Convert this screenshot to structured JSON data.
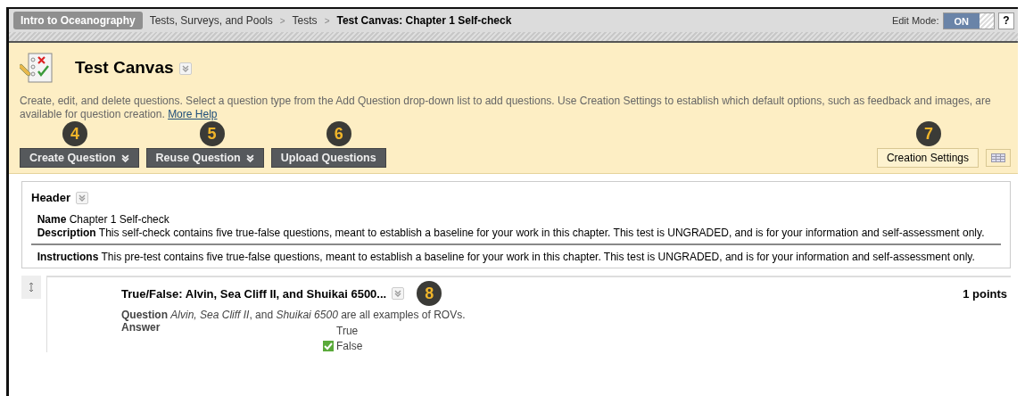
{
  "breadcrumb": {
    "course": "Intro to Oceanography",
    "items": [
      {
        "label": "Tests, Surveys, and Pools",
        "current": false
      },
      {
        "label": "Tests",
        "current": false
      },
      {
        "label": "Test Canvas: Chapter 1 Self-check",
        "current": true
      }
    ],
    "separator": ">"
  },
  "edit_mode": {
    "label": "Edit Mode:",
    "value": "ON",
    "on": true,
    "help": "?"
  },
  "page": {
    "title": "Test Canvas",
    "instructions": "Create, edit, and delete questions. Select a question type from the Add Question drop-down list to add questions. Use Creation Settings to establish which default options, such as feedback and images, are available for question creation.",
    "help_link": "More Help"
  },
  "toolbar": [
    {
      "label": "Create Question",
      "menu": true,
      "callout": "4"
    },
    {
      "label": "Reuse Question",
      "menu": true,
      "callout": "5"
    },
    {
      "label": "Upload Questions",
      "menu": false,
      "callout": "6"
    }
  ],
  "settings_button": {
    "label": "Creation Settings",
    "callout": "7"
  },
  "header": {
    "title": "Header",
    "fields": [
      {
        "label": "Name",
        "value": "Chapter 1 Self-check"
      },
      {
        "label": "Description",
        "value": "This self-check contains five true-false questions, meant to establish a baseline for your work in this chapter. This test is UNGRADED, and is for your information and self-assessment only."
      }
    ],
    "instructions": {
      "label": "Instructions",
      "value": "This pre-test contains five true-false questions, meant to establish a baseline for your work in this chapter. This test is UNGRADED, and is for your information and self-assessment only."
    }
  },
  "questions": [
    {
      "title": "True/False: Alvin, Sea Cliff II, and Shuikai 6500...",
      "callout": "8",
      "points": "1 points",
      "question_label": "Question",
      "question_text": "*Alvin, Sea Cliff II*, and *Shuikai 6500* are all examples of ROVs.",
      "answer_label": "Answer",
      "answers": [
        {
          "text": "True",
          "correct": false
        },
        {
          "text": "False",
          "correct": true
        }
      ]
    }
  ]
}
